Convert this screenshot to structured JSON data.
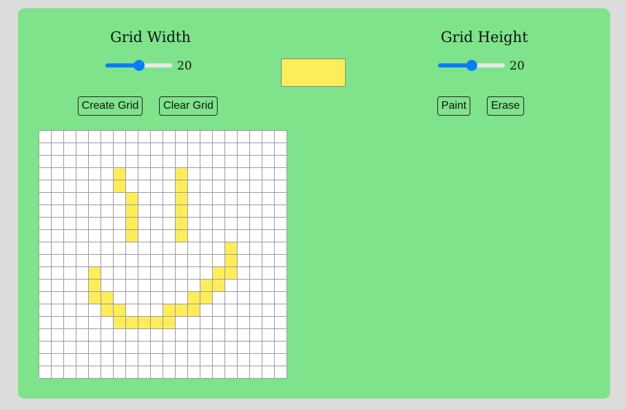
{
  "width_control": {
    "title": "Grid Width",
    "value": "20",
    "slider_fraction": 0.5
  },
  "height_control": {
    "title": "Grid Height",
    "value": "20",
    "slider_fraction": 0.5
  },
  "color_picker": {
    "color": "#fded5b"
  },
  "buttons": {
    "create_grid": "Create Grid",
    "clear_grid": "Clear Grid",
    "paint": "Paint",
    "erase": "Erase"
  },
  "grid": {
    "columns": 20,
    "rows": 20,
    "empty_color": "#ffffff",
    "line_color": "#9a9a9a",
    "painted_cells": [
      [
        3,
        6
      ],
      [
        3,
        11
      ],
      [
        4,
        6
      ],
      [
        4,
        11
      ],
      [
        5,
        7
      ],
      [
        5,
        11
      ],
      [
        6,
        7
      ],
      [
        6,
        11
      ],
      [
        7,
        7
      ],
      [
        7,
        11
      ],
      [
        8,
        7
      ],
      [
        8,
        11
      ],
      [
        9,
        15
      ],
      [
        10,
        15
      ],
      [
        11,
        4
      ],
      [
        11,
        14
      ],
      [
        11,
        15
      ],
      [
        12,
        4
      ],
      [
        12,
        13
      ],
      [
        12,
        14
      ],
      [
        13,
        4
      ],
      [
        13,
        5
      ],
      [
        13,
        12
      ],
      [
        13,
        13
      ],
      [
        14,
        5
      ],
      [
        14,
        6
      ],
      [
        14,
        10
      ],
      [
        14,
        11
      ],
      [
        14,
        12
      ],
      [
        15,
        6
      ],
      [
        15,
        7
      ],
      [
        15,
        8
      ],
      [
        15,
        9
      ],
      [
        15,
        10
      ]
    ]
  },
  "colors": {
    "panel_background": "#7ee38a",
    "page_background": "#dcdcdc",
    "slider_accent": "#0a7cff"
  }
}
